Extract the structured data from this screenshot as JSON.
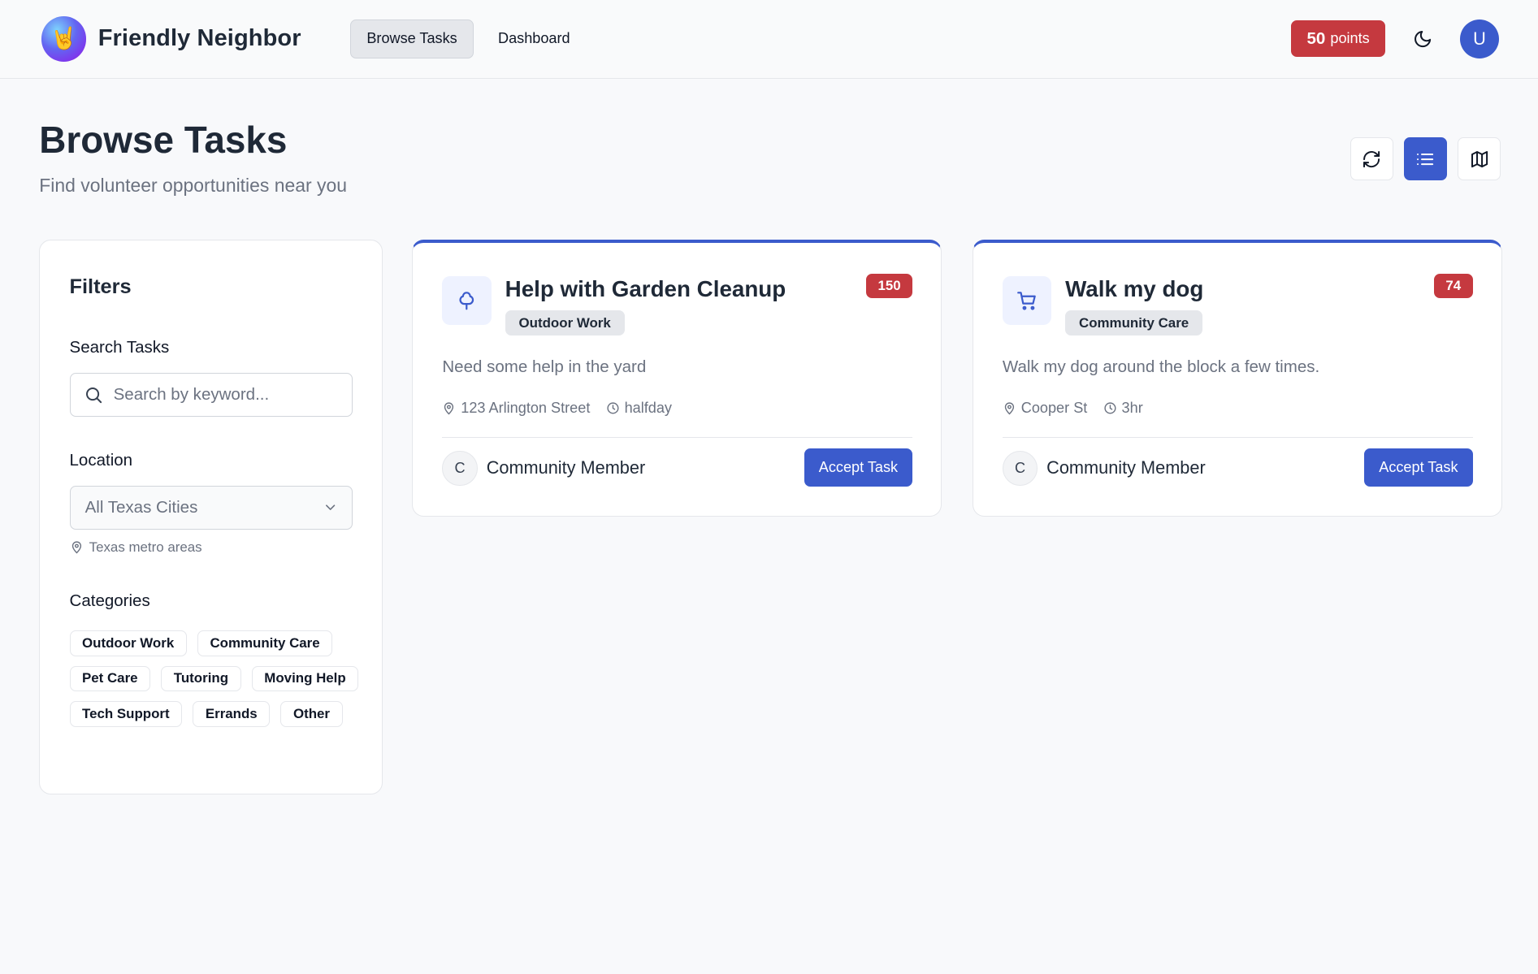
{
  "brand": {
    "name": "Friendly Neighbor",
    "logo_icon": "rock-hand-icon"
  },
  "nav": {
    "items": [
      {
        "label": "Browse Tasks",
        "active": true
      },
      {
        "label": "Dashboard",
        "active": false
      }
    ]
  },
  "header": {
    "points_value": "50",
    "points_suffix": "points",
    "avatar_initial": "U",
    "theme_icon": "moon-icon"
  },
  "main": {
    "title": "Browse Tasks",
    "subtitle": "Find volunteer opportunities near you",
    "view_buttons": [
      {
        "icon": "refresh-icon"
      },
      {
        "icon": "list-icon",
        "active": true
      },
      {
        "icon": "map-icon"
      }
    ]
  },
  "filters": {
    "title": "Filters",
    "search_label": "Search Tasks",
    "search_placeholder": "Search by keyword...",
    "location_label": "Location",
    "location_value": "All Texas Cities",
    "location_hint": "Texas metro areas",
    "categories_label": "Categories",
    "categories": [
      "Outdoor Work",
      "Community Care",
      "Pet Care",
      "Tutoring",
      "Moving Help",
      "Tech Support",
      "Errands",
      "Other"
    ]
  },
  "tasks": [
    {
      "title": "Help with Garden Cleanup",
      "category": "Outdoor Work",
      "points": "150",
      "description": "Need some help in the yard",
      "location": "123 Arlington Street",
      "duration": "halfday",
      "poster_initial": "C",
      "poster_name": "Community Member",
      "action": "Accept Task",
      "icon": "tree-icon"
    },
    {
      "title": "Walk my dog",
      "category": "Community Care",
      "points": "74",
      "description": "Walk my dog around the block a few times.",
      "location": "Cooper St",
      "duration": "3hr",
      "poster_initial": "C",
      "poster_name": "Community Member",
      "action": "Accept Task",
      "icon": "shopping-cart-icon"
    }
  ],
  "colors": {
    "accent": "#3b5bcc",
    "danger": "#c5393f",
    "muted": "#6b7280",
    "background": "#f8f9fb"
  }
}
